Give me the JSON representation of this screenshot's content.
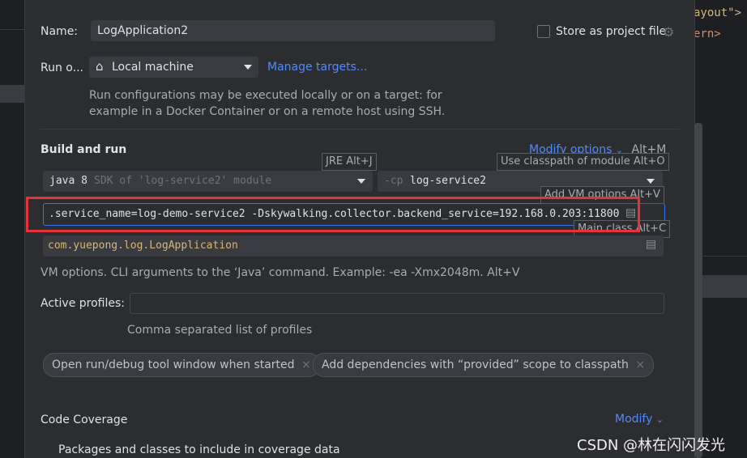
{
  "dialog": {
    "name_label": "Name:",
    "name_value": "LogApplication2",
    "store_label": "Store as project file",
    "run_on_label": "Run o...",
    "target_value": "Local machine",
    "manage_targets": "Manage targets...",
    "run_info_line1": "Run configurations may be executed locally or on a target: for",
    "run_info_line2": "example in a Docker Container or on a remote host using SSH.",
    "build_run_heading": "Build and run",
    "modify_options": "Modify options",
    "modify_options_shortcut": "Alt+M",
    "jre_hint": "JRE Alt+J",
    "classpath_hint": "Use classpath of module Alt+O",
    "add_vm_hint": "Add VM options Alt+V",
    "main_class_hint": "Main class Alt+C",
    "sdk_main": "java 8",
    "sdk_sub": "SDK of 'log-service2' module",
    "cp_prefix": "-cp",
    "cp_value": "log-service2",
    "vm_options_value": ".service_name=log-demo-service2 -Dskywalking.collector.backend_service=192.168.0.203:11800",
    "main_class_value": "com.yuepong.log.LogApplication",
    "vm_help": "VM options. CLI arguments to the ‘Java’ command. Example: -ea -Xmx2048m. Alt+V",
    "active_profiles_label": "Active profiles:",
    "profiles_help": "Comma separated list of profiles",
    "chip1": "Open run/debug tool window when started",
    "chip2": "Add dependencies with “provided” scope to classpath",
    "chip_close": "×",
    "coverage_heading": "Code Coverage",
    "coverage_modify": "Modify",
    "coverage_packages": "Packages and classes to include in coverage data"
  },
  "editor": {
    "code_line1": "ayout\">",
    "code_line2": "ern>"
  },
  "watermark": "CSDN @林在闪闪发光",
  "colors": {
    "accent": "#548af7",
    "highlight_red": "#e5333a",
    "background": "#2b2d30",
    "focus_border": "#3574f0"
  }
}
